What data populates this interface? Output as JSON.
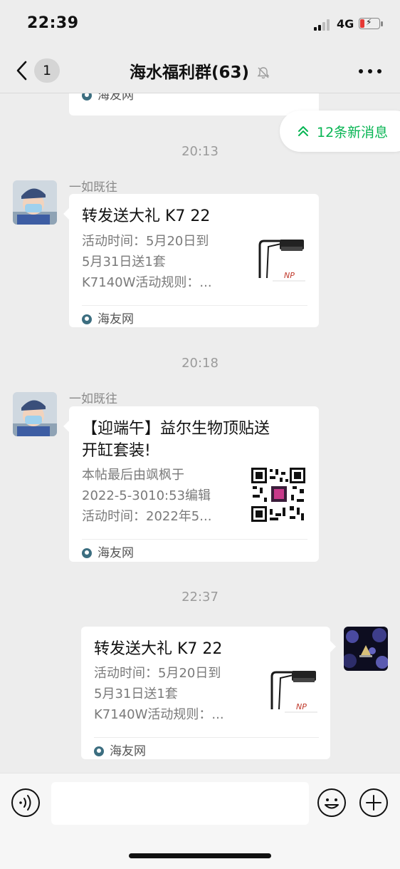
{
  "status": {
    "time": "22:39",
    "network": "4G"
  },
  "nav": {
    "unread_count": "1",
    "title": "海水福利群(63)"
  },
  "new_messages": {
    "label": "12条新消息"
  },
  "chat": {
    "partial_top_card": {
      "source": "海友网"
    },
    "messages": [
      {
        "timestamp": "20:13",
        "sender": "一如既往",
        "side": "left",
        "card": {
          "title": "转发送大礼 K7 22",
          "desc_lines": [
            "活动时间：5月20日到",
            "5月31日送1套",
            "K7140W活动规则：..."
          ],
          "source": "海友网",
          "thumb": "aquarium-light-product-image"
        }
      },
      {
        "timestamp": "20:18",
        "sender": "一如既往",
        "side": "left",
        "card": {
          "title_lines": [
            "【迎端午】益尔生物顶贴送",
            "开缸套装!"
          ],
          "desc_lines": [
            "本帖最后由飒枫于",
            "2022-5-3010:53编辑",
            "活动时间：2022年5..."
          ],
          "source": "海友网",
          "thumb": "qr-code-image"
        }
      },
      {
        "timestamp": "22:37",
        "side": "right",
        "card": {
          "title": "转发送大礼 K7 22",
          "desc_lines": [
            "活动时间：5月20日到",
            "5月31日送1套",
            "K7140W活动规则：..."
          ],
          "source": "海友网",
          "thumb": "aquarium-light-product-image"
        }
      }
    ]
  },
  "input": {
    "placeholder": ""
  },
  "colors": {
    "accent_green": "#07b553",
    "bubble": "#ffffff",
    "background": "#ededed"
  }
}
